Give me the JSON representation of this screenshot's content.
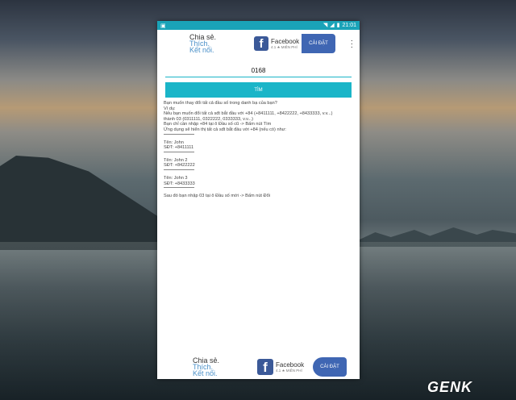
{
  "status_bar": {
    "time": "21:01"
  },
  "ad_top": {
    "tagline_1": "Chia sẻ.",
    "tagline_2": "Thích.",
    "tagline_3": "Kết nối.",
    "app_name": "Facebook",
    "rating": "4.1 ★ MIỄN PHÍ",
    "install_label": "CÀI ĐẶT"
  },
  "search": {
    "value": "0168"
  },
  "tim_button_label": "TÌM",
  "instructions": [
    "Bạn muốn thay đổi tất cả đầu số trong danh bạ của bạn?",
    "Ví dụ:",
    "Nếu bạn muốn đổi tất cả sđt bắt đầu với +84 (+8411111, +8422222, +8433333, v.v...)",
    "thành 03 (0311111, 0322222, 0333333, v.v...)",
    "Bạn chỉ cần nhập +84 tại ô Đầu số cũ -> Bấm nút Tìm",
    "Ứng dụng sẽ hiển thị tất cả sđt bắt đầu với +84 (nếu có) như:"
  ],
  "contacts": [
    {
      "name": "Tên: John",
      "phone": "SĐT: +8411111"
    },
    {
      "name": "Tên: John 2",
      "phone": "SĐT: +8422222"
    },
    {
      "name": "Tên: John 3",
      "phone": "SĐT: +8433333"
    }
  ],
  "footer_text": "Sau đó bạn nhập 03 tại ô Đầu số mới -> Bấm nút Đổi",
  "ad_bottom": {
    "tagline_1": "Chia sẻ.",
    "tagline_2": "Thích.",
    "tagline_3": "Kết nối.",
    "app_name": "Facebook",
    "rating": "4.1 ★ MIỄN PHÍ",
    "install_label": "CÀI ĐẶT"
  },
  "watermark": "GENK",
  "colors": {
    "accent": "#1ab5c8",
    "status_bar": "#1aa3b8",
    "install": "#3f66b3"
  }
}
